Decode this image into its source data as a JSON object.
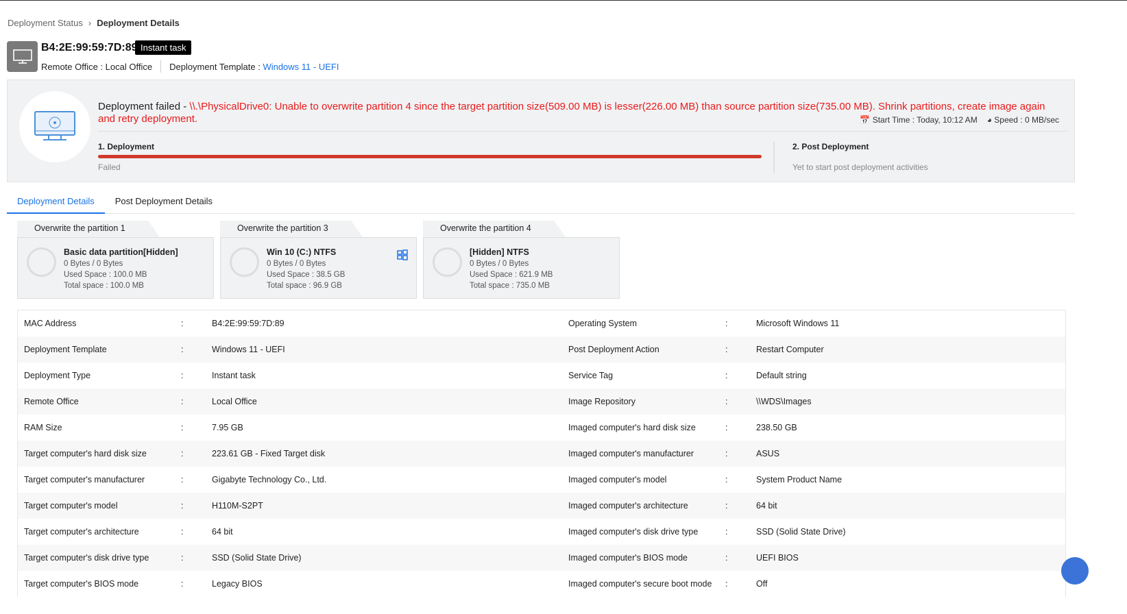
{
  "breadcrumb": {
    "parent": "Deployment Status",
    "current": "Deployment Details"
  },
  "header": {
    "mac": "B4:2E:99:59:7D:89",
    "badge": "Instant task",
    "remote_office": "Remote Office : Local Office",
    "template_label": "Deployment Template : ",
    "template_value": "Windows 11 - UEFI"
  },
  "status": {
    "prefix": "Deployment failed - ",
    "error": "\\\\.\\PhysicalDrive0: Unable to overwrite partition 4 since the target partition size(509.00 MB) is lesser(226.00 MB) than source partition size(735.00 MB). Shrink partitions, create image again and retry deployment.",
    "start_time": "Start Time : Today, 10:12 AM",
    "speed": "Speed : 0 MB/sec",
    "step1": "1. Deployment",
    "step1_status": "Failed",
    "step1_progress": 100,
    "step2": "2. Post Deployment",
    "step2_status": "Yet to start post deployment activities"
  },
  "tabs": [
    "Deployment Details",
    "Post Deployment Details"
  ],
  "partitions": [
    {
      "tab": "Overwrite the partition 1",
      "name": "Basic data partition[Hidden]",
      "bytes": "0 Bytes / 0 Bytes",
      "used": "Used Space : 100.0 MB",
      "total": "Total space : 100.0 MB"
    },
    {
      "tab": "Overwrite the partition 3",
      "name": "Win 10 (C:) NTFS",
      "bytes": "0 Bytes / 0 Bytes",
      "used": "Used Space : 38.5 GB",
      "total": "Total space : 96.9 GB"
    },
    {
      "tab": "Overwrite the partition 4",
      "name": "[Hidden] NTFS",
      "bytes": "0 Bytes / 0 Bytes",
      "used": "Used Space : 621.9 MB",
      "total": "Total space : 735.0 MB"
    }
  ],
  "details": [
    [
      "MAC Address",
      "B4:2E:99:59:7D:89",
      "Operating System",
      "Microsoft Windows 11"
    ],
    [
      "Deployment Template",
      "Windows 11 - UEFI",
      "Post Deployment Action",
      "Restart Computer"
    ],
    [
      "Deployment Type",
      "Instant task",
      "Service Tag",
      "Default string"
    ],
    [
      "Remote Office",
      "Local Office",
      "Image Repository",
      "\\\\WDS\\Images"
    ],
    [
      "RAM Size",
      "7.95 GB",
      "Imaged computer's hard disk size",
      "238.50 GB"
    ],
    [
      "Target computer's hard disk size",
      "223.61 GB - Fixed Target disk",
      "Imaged computer's manufacturer",
      "ASUS"
    ],
    [
      "Target computer's manufacturer",
      "Gigabyte Technology Co., Ltd.",
      "Imaged computer's model",
      "System Product Name"
    ],
    [
      "Target computer's model",
      "H110M-S2PT",
      "Imaged computer's architecture",
      "64 bit"
    ],
    [
      "Target computer's architecture",
      "64 bit",
      "Imaged computer's disk drive type",
      "SSD (Solid State Drive)"
    ],
    [
      "Target computer's disk drive type",
      "SSD (Solid State Drive)",
      "Imaged computer's BIOS mode",
      "UEFI BIOS"
    ],
    [
      "Target computer's BIOS mode",
      "Legacy BIOS",
      "Imaged computer's secure boot mode",
      "Off"
    ]
  ],
  "colon": ":"
}
